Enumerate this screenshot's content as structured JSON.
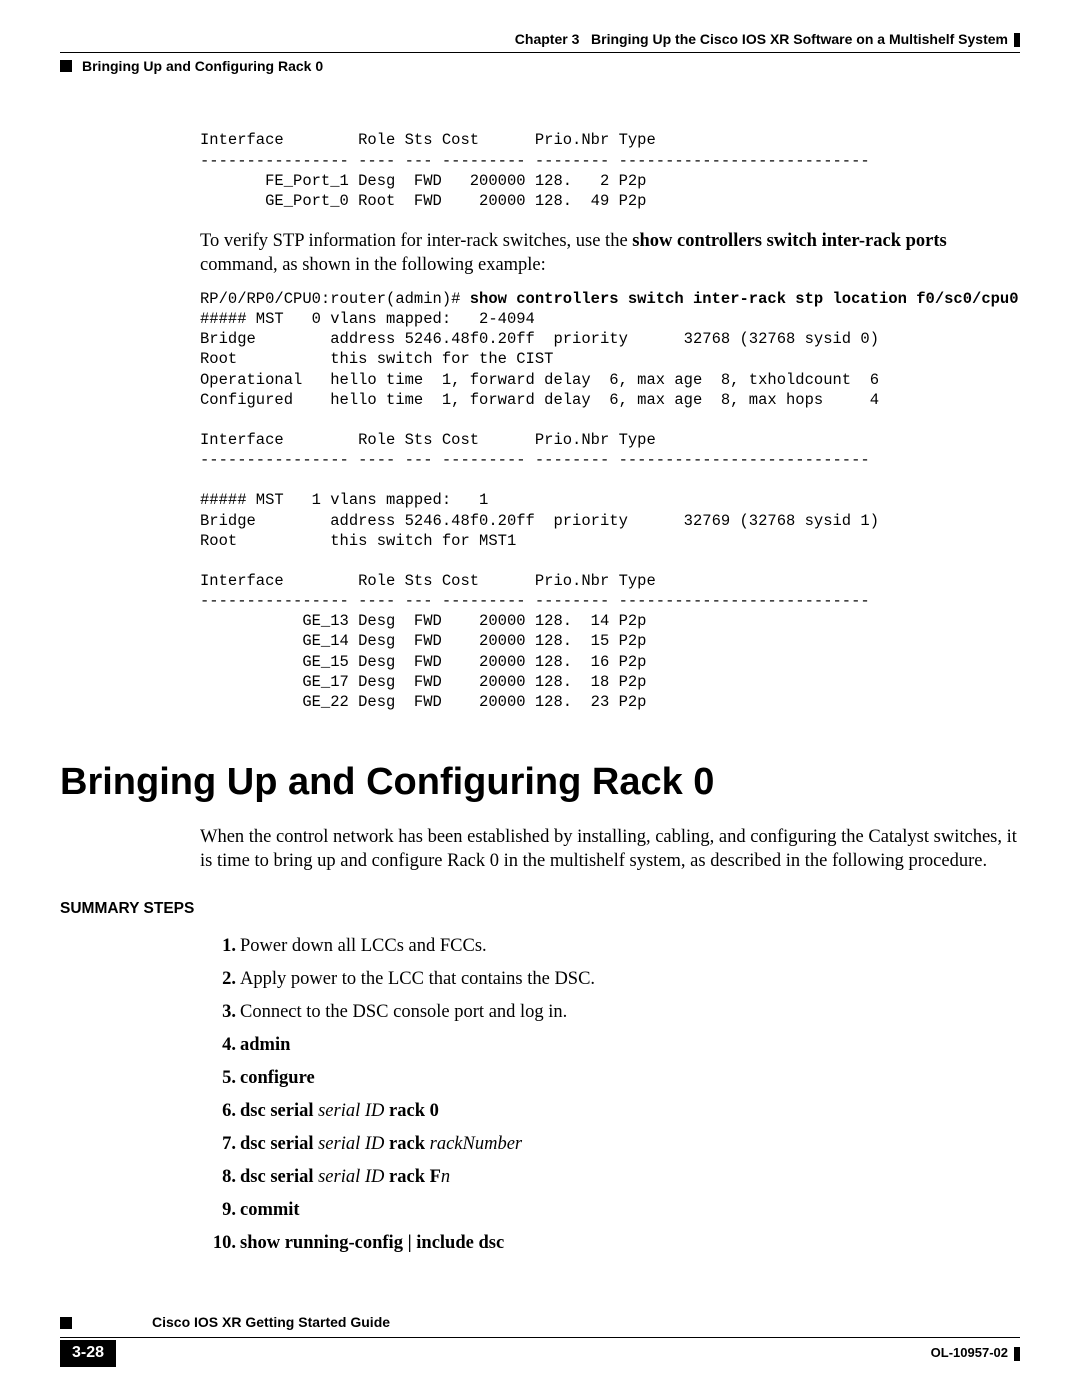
{
  "header": {
    "chapter_label": "Chapter 3",
    "chapter_title": "Bringing Up the Cisco IOS XR Software on a Multishelf System",
    "section_title": "Bringing Up and Configuring Rack 0"
  },
  "code_block_1": "Interface        Role Sts Cost      Prio.Nbr Type\n---------------- ---- --- --------- -------- ---------------------------\n       FE_Port_1 Desg  FWD   200000 128.   2 P2p\n       GE_Port_0 Root  FWD    20000 128.  49 P2p",
  "paragraph_1_pre": "To verify STP information for inter-rack switches, use the ",
  "paragraph_1_cmd": "show controllers switch inter-rack ports",
  "paragraph_1_post": " command, as shown in the following example:",
  "code_prompt": "RP/0/RP0/CPU0:router(admin)# ",
  "code_cmd": "show controllers switch inter-rack stp location f0/sc0/cpu0",
  "code_block_2": "\n##### MST   0 vlans mapped:   2-4094\nBridge        address 5246.48f0.20ff  priority      32768 (32768 sysid 0)\nRoot          this switch for the CIST\nOperational   hello time  1, forward delay  6, max age  8, txholdcount  6\nConfigured    hello time  1, forward delay  6, max age  8, max hops     4\n\nInterface        Role Sts Cost      Prio.Nbr Type\n---------------- ---- --- --------- -------- ---------------------------\n\n##### MST   1 vlans mapped:   1\nBridge        address 5246.48f0.20ff  priority      32769 (32768 sysid 1)\nRoot          this switch for MST1\n\nInterface        Role Sts Cost      Prio.Nbr Type\n---------------- ---- --- --------- -------- ---------------------------\n           GE_13 Desg  FWD    20000 128.  14 P2p\n           GE_14 Desg  FWD    20000 128.  15 P2p\n           GE_15 Desg  FWD    20000 128.  16 P2p\n           GE_17 Desg  FWD    20000 128.  18 P2p\n           GE_22 Desg  FWD    20000 128.  23 P2p",
  "heading": "Bringing Up and Configuring Rack 0",
  "intro_paragraph": "When the control network has been established by installing, cabling, and configuring the Catalyst switches, it is time to bring up and configure Rack 0 in the multishelf system, as described in the following procedure.",
  "summary_label": "SUMMARY STEPS",
  "steps": [
    {
      "plain": "Power down all LCCs and FCCs."
    },
    {
      "plain": "Apply power to the LCC that contains the DSC."
    },
    {
      "plain": "Connect to the DSC console port and log in."
    },
    {
      "bold": "admin"
    },
    {
      "bold": "configure"
    },
    {
      "bold1": "dsc serial ",
      "italic": "serial ID",
      "bold2": " rack 0"
    },
    {
      "bold1": "dsc serial ",
      "italic": "serial ID",
      "bold2": " rack ",
      "italic2": "rackNumber"
    },
    {
      "bold1": "dsc serial ",
      "italic": "serial ID",
      "bold2": " rack F",
      "italic2": "n"
    },
    {
      "bold": "commit"
    },
    {
      "bold": "show running-config | include dsc"
    }
  ],
  "footer": {
    "guide_title": "Cisco IOS XR Getting Started Guide",
    "page_num": "3-28",
    "doc_id": "OL-10957-02"
  }
}
